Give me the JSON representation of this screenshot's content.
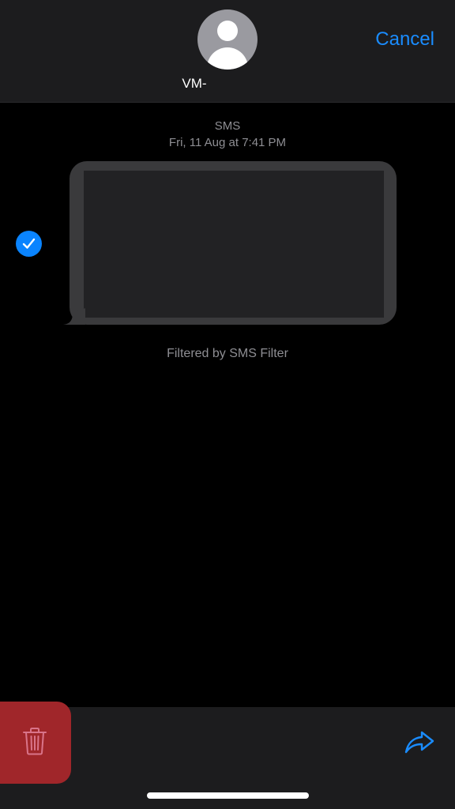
{
  "header": {
    "contact_name": "VM-",
    "cancel_label": "Cancel",
    "avatar_icon": "person-silhouette-icon"
  },
  "message": {
    "type_label": "SMS",
    "timestamp": "Fri, 11 Aug at 7:41 PM",
    "selected": true,
    "filter_note": "Filtered by SMS Filter"
  },
  "toolbar": {
    "delete_icon": "trash-icon",
    "share_icon": "share-arrow-icon"
  },
  "colors": {
    "accent": "#0a84ff",
    "delete_bg": "#a0262a",
    "bar_bg": "#1c1c1e",
    "bubble_bg": "#3a3a3c",
    "secondary_text": "#8e8e93"
  }
}
